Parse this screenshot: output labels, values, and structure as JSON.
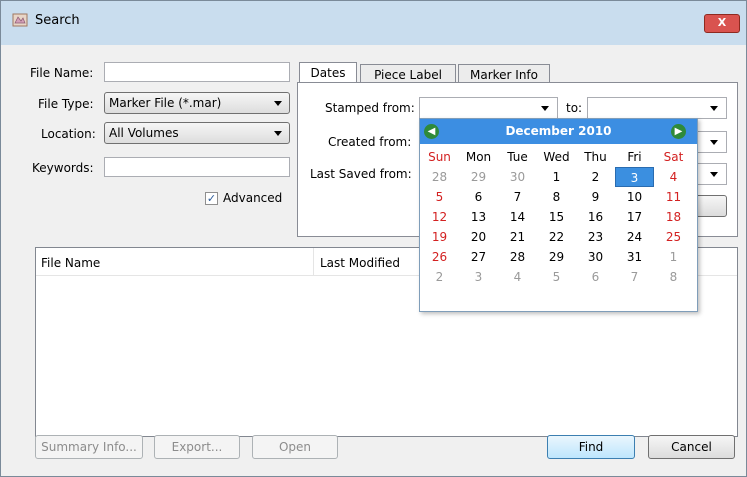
{
  "window": {
    "title": "Search",
    "close_glyph": "X"
  },
  "form": {
    "file_name_label": "File Name:",
    "file_name_value": "",
    "file_type_label": "File Type:",
    "file_type_value": "Marker File (*.mar)",
    "location_label": "Location:",
    "location_value": "All Volumes",
    "keywords_label": "Keywords:",
    "keywords_value": "",
    "advanced_label": "Advanced",
    "advanced_checked": true
  },
  "tabs": [
    {
      "label": "Dates"
    },
    {
      "label": "Piece Label"
    },
    {
      "label": "Marker Info"
    }
  ],
  "dates": {
    "stamped_from_label": "Stamped from:",
    "to_label": "to:",
    "created_from_label": "Created from:",
    "last_saved_from_label": "Last Saved from:"
  },
  "results": {
    "columns": [
      "File Name",
      "Last Modified"
    ],
    "rows": []
  },
  "buttons": {
    "summary_info": "Summary Info...",
    "export": "Export...",
    "open": "Open",
    "find": "Find",
    "cancel": "Cancel"
  },
  "calendar": {
    "month_year": "December 2010",
    "day_names": [
      "Sun",
      "Mon",
      "Tue",
      "Wed",
      "Thu",
      "Fri",
      "Sat"
    ],
    "weeks": [
      [
        "28",
        "29",
        "30",
        "1",
        "2",
        "3",
        "4"
      ],
      [
        "5",
        "6",
        "7",
        "8",
        "9",
        "10",
        "11"
      ],
      [
        "12",
        "13",
        "14",
        "15",
        "16",
        "17",
        "18"
      ],
      [
        "19",
        "20",
        "21",
        "22",
        "23",
        "24",
        "25"
      ],
      [
        "26",
        "27",
        "28",
        "29",
        "30",
        "31",
        "1"
      ],
      [
        "2",
        "3",
        "4",
        "5",
        "6",
        "7",
        "8"
      ]
    ],
    "selected_day": "3",
    "colors": {
      "header": "#3c8ee2",
      "weekend": "#d32121",
      "other_month": "#9a9a9a",
      "selected": "#3b8fe0"
    }
  }
}
